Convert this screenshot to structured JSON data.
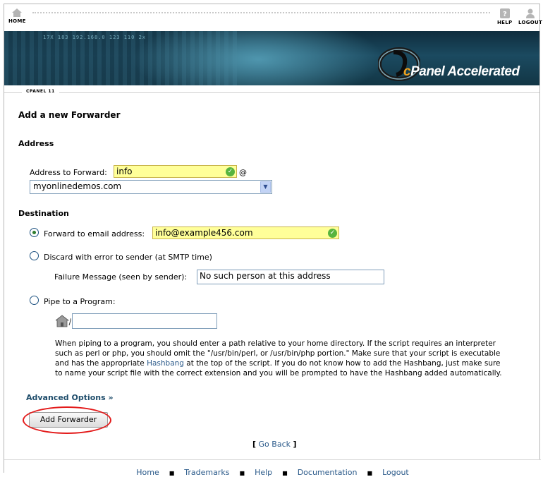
{
  "toolbar": {
    "home_label": "HOME",
    "help_label": "HELP",
    "logout_label": "LOGOUT"
  },
  "banner": {
    "logo_c": "c",
    "logo_text": "Panel Accelerated",
    "numbers": "17X   183   192.168.0   123   110   2x"
  },
  "version_label": "CPANEL 11",
  "page_title": "Add a new Forwarder",
  "address": {
    "section_title": "Address",
    "forward_label": "Address to Forward:",
    "forward_value": "info",
    "at_sign": "@",
    "domain_value": "myonlinedemos.com"
  },
  "destination": {
    "section_title": "Destination",
    "email_option_label": "Forward to email address:",
    "email_value": "info@example456.com",
    "discard_option_label": "Discard with error to sender (at SMTP time)",
    "failure_label": "Failure Message (seen by sender):",
    "failure_value": "No such person at this address",
    "pipe_option_label": "Pipe to a Program:",
    "pipe_value": "",
    "pipe_help_1": "When piping to a program, you should enter a path relative to your home directory. If the script requires an interpreter such as perl or php, you should omit the \"/usr/bin/perl, or /usr/bin/php portion.\" Make sure that your script is executable and has the appropriate ",
    "pipe_help_link": "Hashbang",
    "pipe_help_2": " at the top of the script. If you do not know how to add the Hashbang, just make sure to name your script file with the correct extension and you will be prompted to have the Hashbang added automatically."
  },
  "advanced_options": "Advanced Options »",
  "submit_label": "Add Forwarder",
  "go_back": {
    "open": "[",
    "label": "Go Back",
    "close": "]"
  },
  "footer": {
    "links": [
      "Home",
      "Trademarks",
      "Help",
      "Documentation",
      "Logout"
    ]
  },
  "colors": {
    "link": "#2b5a8a",
    "highlight_circle": "#e31b1b",
    "valid_field": "#ffff99",
    "ok_check": "#58b43f"
  }
}
